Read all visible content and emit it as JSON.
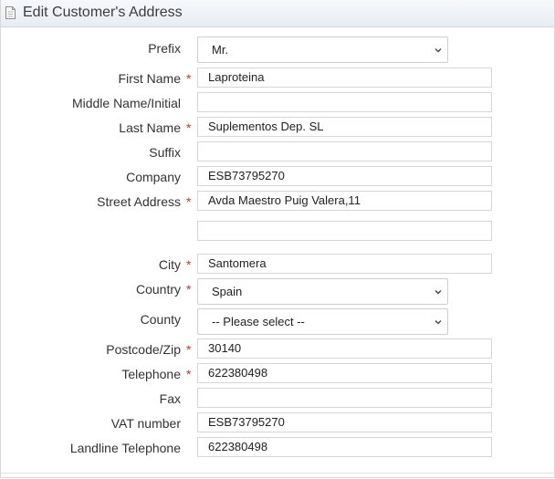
{
  "panel": {
    "title": "Edit Customer's Address",
    "icon": "document-icon"
  },
  "form": {
    "prefix": {
      "label": "Prefix",
      "value": "Mr."
    },
    "first_name": {
      "label": "First Name",
      "required": "*",
      "value": "Laproteina"
    },
    "middle_name": {
      "label": "Middle Name/Initial",
      "value": ""
    },
    "last_name": {
      "label": "Last Name",
      "required": "*",
      "value": "Suplementos Dep. SL"
    },
    "suffix": {
      "label": "Suffix",
      "value": ""
    },
    "company": {
      "label": "Company",
      "value": "ESB73795270"
    },
    "street": {
      "label": "Street Address",
      "required": "*",
      "line1": "Avda Maestro Puig Valera,11",
      "line2": ""
    },
    "city": {
      "label": "City",
      "required": "*",
      "value": "Santomera"
    },
    "country": {
      "label": "Country",
      "required": "*",
      "value": "Spain"
    },
    "county": {
      "label": "County",
      "value": "-- Please select --"
    },
    "postcode": {
      "label": "Postcode/Zip",
      "required": "*",
      "value": "30140"
    },
    "telephone": {
      "label": "Telephone",
      "required": "*",
      "value": "622380498"
    },
    "fax": {
      "label": "Fax",
      "value": ""
    },
    "vat": {
      "label": "VAT number",
      "value": "ESB73795270"
    },
    "landline": {
      "label": "Landline Telephone",
      "value": "622380498"
    }
  },
  "colors": {
    "required": "#d32f2f",
    "header_bg": "#e8edf4",
    "field_border": "#d6d6d6"
  }
}
